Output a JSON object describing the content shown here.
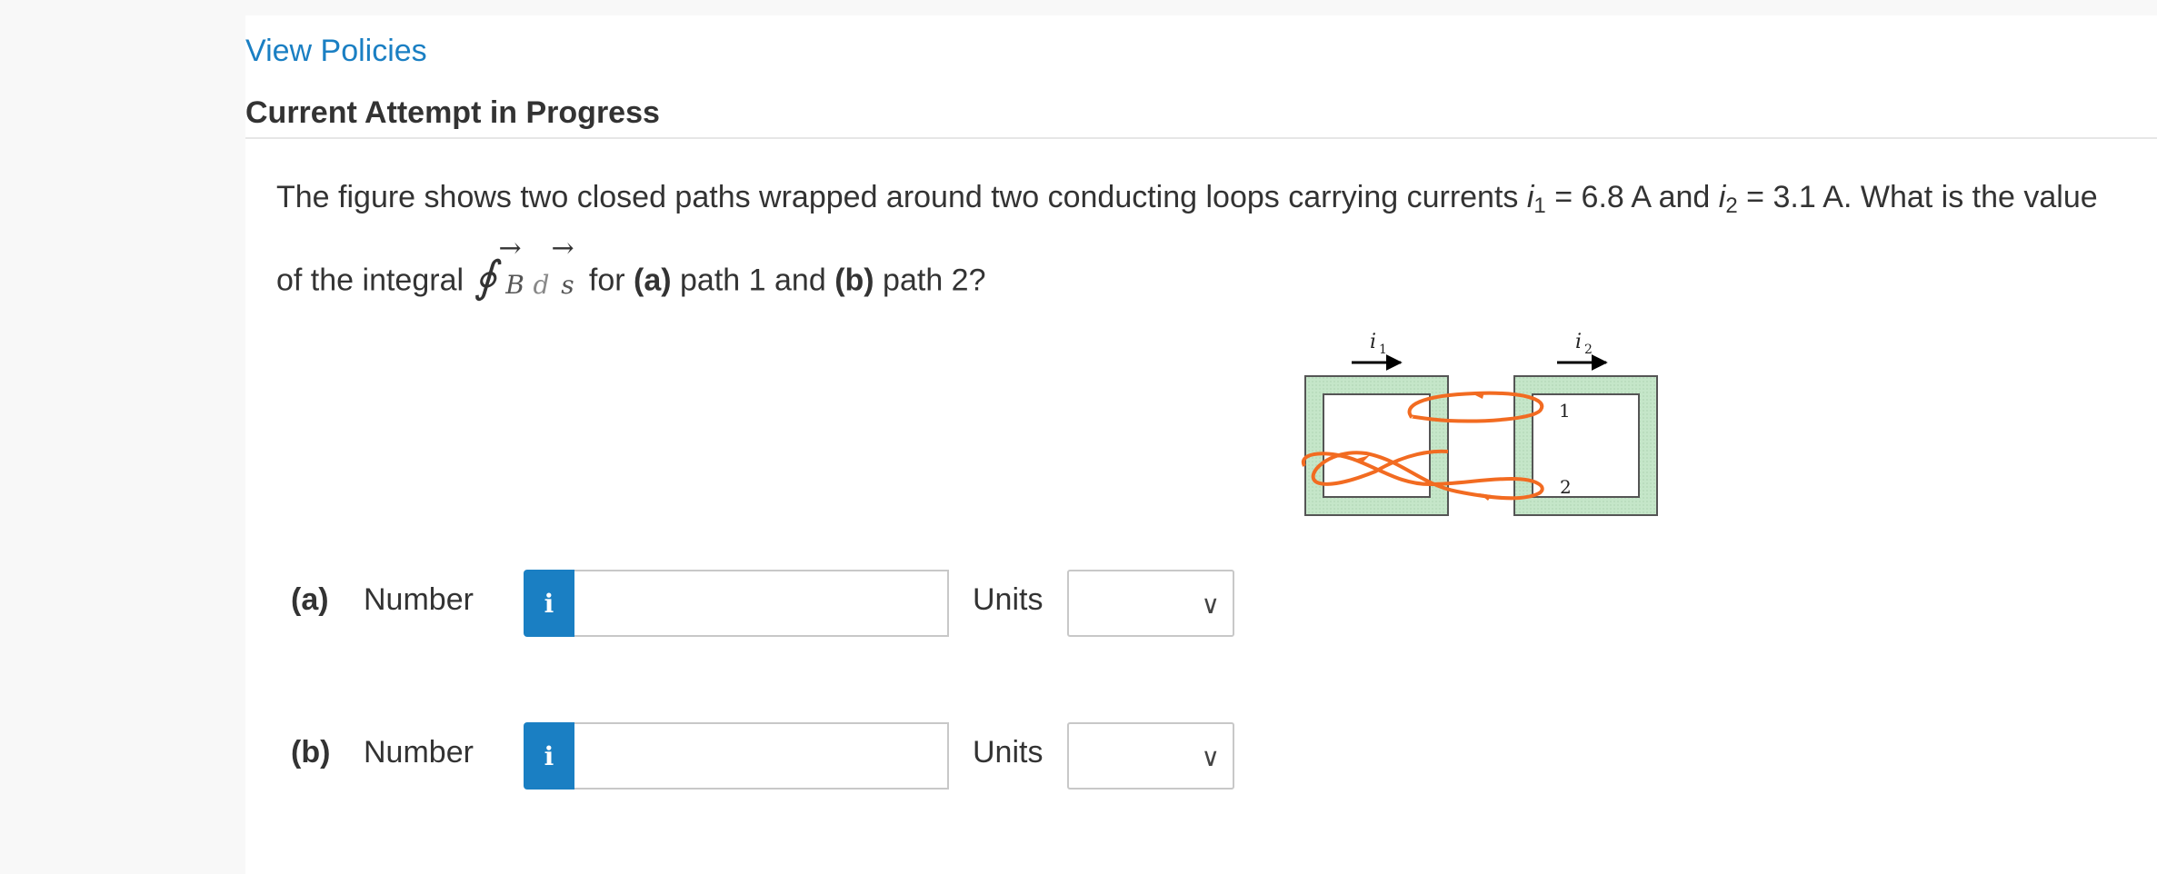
{
  "header": {
    "view_policies": "View Policies",
    "attempt_title": "Current Attempt in Progress"
  },
  "question": {
    "line1_text": "The figure shows two closed paths wrapped around two conducting loops carrying currents ",
    "i_symbol": "i",
    "i1_sub": "1",
    "i1_value": " = 6.8 A and ",
    "i2_sub": "2",
    "i2_value": " = 3.1 A. What is the value",
    "line2_prefix": "of the integral ",
    "integral_symbol": "∮",
    "B": "B",
    "d": "d",
    "s": "s",
    "arrow": "→",
    "for_text": " for ",
    "part_a": "(a)",
    "path1_text": " path 1 and ",
    "part_b": "(b)",
    "path2_text": " path 2?"
  },
  "figure": {
    "i1_label": "i",
    "i1_sub": "1",
    "i2_label": "i",
    "i2_sub": "2",
    "path1_label": "1",
    "path2_label": "2",
    "loop_color": "#c5e6c9",
    "path_color": "#f26b21"
  },
  "answers": [
    {
      "part": "(a)",
      "number_label": "Number",
      "info_icon": "i",
      "number_value": "",
      "units_label": "Units",
      "units_value": ""
    },
    {
      "part": "(b)",
      "number_label": "Number",
      "info_icon": "i",
      "number_value": "",
      "units_label": "Units",
      "units_value": ""
    }
  ],
  "colors": {
    "link": "#1a7fc3",
    "info_button": "#1a7fc3",
    "text": "#333333"
  }
}
